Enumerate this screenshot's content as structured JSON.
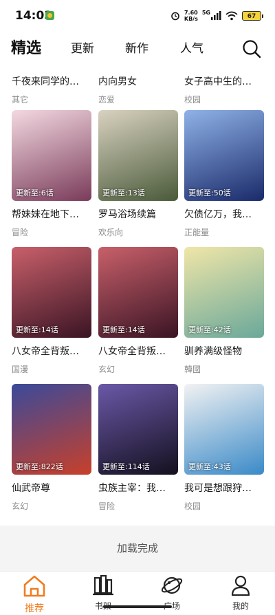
{
  "status": {
    "time": "14:03",
    "net_speed": "7.60",
    "net_unit": "KB/s",
    "signal": "5G",
    "battery": "67"
  },
  "tabs": [
    "精选",
    "更新",
    "新作",
    "人气"
  ],
  "top_row": [
    {
      "title": "千夜来同学的…",
      "tag": "其它"
    },
    {
      "title": "内向男女",
      "tag": "恋爱"
    },
    {
      "title": "女子高中生的…",
      "tag": "校园"
    }
  ],
  "cards": [
    {
      "title": "帮妹妹在地下…",
      "tag": "冒险",
      "update": "更新至:6话",
      "c1": "#f3d9e1",
      "c2": "#7a3b5a"
    },
    {
      "title": "罗马浴场续篇",
      "tag": "欢乐向",
      "update": "更新至:13话",
      "c1": "#d9d2c0",
      "c2": "#4a5a3a"
    },
    {
      "title": "欠债亿万，我…",
      "tag": "正能量",
      "update": "更新至:50话",
      "c1": "#8fb2e8",
      "c2": "#1a2a6a"
    },
    {
      "title": "八女帝全背叛…",
      "tag": "国漫",
      "update": "更新至:14话",
      "c1": "#c8606a",
      "c2": "#3a1424"
    },
    {
      "title": "八女帝全背叛…",
      "tag": "玄幻",
      "update": "更新至:14话",
      "c1": "#c8606a",
      "c2": "#3a1424"
    },
    {
      "title": "驯养满级怪物",
      "tag": "韓國",
      "update": "更新至:42话",
      "c1": "#f0e6a8",
      "c2": "#6aa89a"
    },
    {
      "title": "仙武帝尊",
      "tag": "玄幻",
      "update": "更新至:822话",
      "c1": "#3a4a9a",
      "c2": "#c8402a"
    },
    {
      "title": "虫族主宰：我…",
      "tag": "冒险",
      "update": "更新至:114话",
      "c1": "#6a58a8",
      "c2": "#14101e"
    },
    {
      "title": "我可是想跟狩…",
      "tag": "校园",
      "update": "更新至:43话",
      "c1": "#f2f2f2",
      "c2": "#3a8ac8"
    }
  ],
  "load_complete": "加载完成",
  "bottom_nav": [
    {
      "label": "推荐",
      "icon": "home-icon",
      "active": true
    },
    {
      "label": "书架",
      "icon": "bookshelf-icon",
      "active": false
    },
    {
      "label": "广场",
      "icon": "planet-icon",
      "active": false
    },
    {
      "label": "我的",
      "icon": "person-icon",
      "active": false
    }
  ],
  "colors": {
    "accent": "#f07c1e"
  }
}
